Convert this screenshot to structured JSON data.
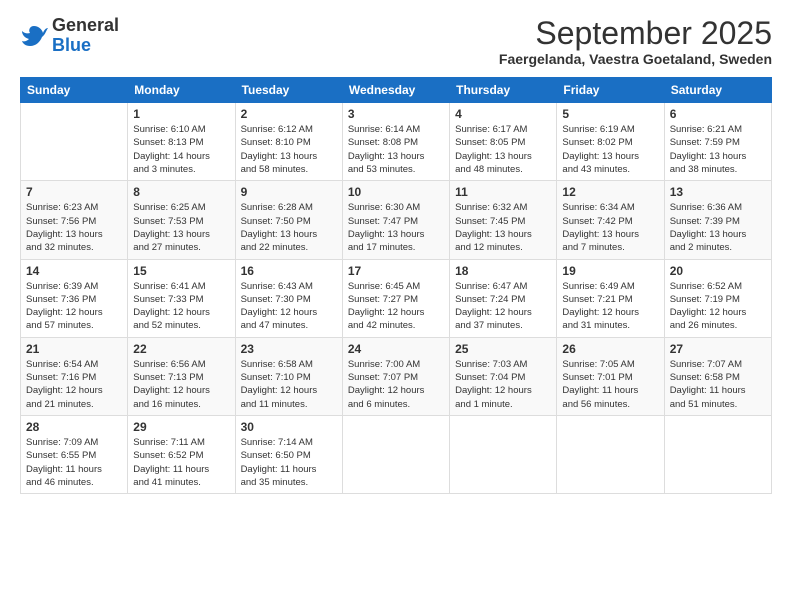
{
  "logo": {
    "general": "General",
    "blue": "Blue"
  },
  "header": {
    "month_title": "September 2025",
    "location": "Faergelanda, Vaestra Goetaland, Sweden"
  },
  "days_of_week": [
    "Sunday",
    "Monday",
    "Tuesday",
    "Wednesday",
    "Thursday",
    "Friday",
    "Saturday"
  ],
  "weeks": [
    [
      {
        "day": "",
        "info": ""
      },
      {
        "day": "1",
        "info": "Sunrise: 6:10 AM\nSunset: 8:13 PM\nDaylight: 14 hours\nand 3 minutes."
      },
      {
        "day": "2",
        "info": "Sunrise: 6:12 AM\nSunset: 8:10 PM\nDaylight: 13 hours\nand 58 minutes."
      },
      {
        "day": "3",
        "info": "Sunrise: 6:14 AM\nSunset: 8:08 PM\nDaylight: 13 hours\nand 53 minutes."
      },
      {
        "day": "4",
        "info": "Sunrise: 6:17 AM\nSunset: 8:05 PM\nDaylight: 13 hours\nand 48 minutes."
      },
      {
        "day": "5",
        "info": "Sunrise: 6:19 AM\nSunset: 8:02 PM\nDaylight: 13 hours\nand 43 minutes."
      },
      {
        "day": "6",
        "info": "Sunrise: 6:21 AM\nSunset: 7:59 PM\nDaylight: 13 hours\nand 38 minutes."
      }
    ],
    [
      {
        "day": "7",
        "info": "Sunrise: 6:23 AM\nSunset: 7:56 PM\nDaylight: 13 hours\nand 32 minutes."
      },
      {
        "day": "8",
        "info": "Sunrise: 6:25 AM\nSunset: 7:53 PM\nDaylight: 13 hours\nand 27 minutes."
      },
      {
        "day": "9",
        "info": "Sunrise: 6:28 AM\nSunset: 7:50 PM\nDaylight: 13 hours\nand 22 minutes."
      },
      {
        "day": "10",
        "info": "Sunrise: 6:30 AM\nSunset: 7:47 PM\nDaylight: 13 hours\nand 17 minutes."
      },
      {
        "day": "11",
        "info": "Sunrise: 6:32 AM\nSunset: 7:45 PM\nDaylight: 13 hours\nand 12 minutes."
      },
      {
        "day": "12",
        "info": "Sunrise: 6:34 AM\nSunset: 7:42 PM\nDaylight: 13 hours\nand 7 minutes."
      },
      {
        "day": "13",
        "info": "Sunrise: 6:36 AM\nSunset: 7:39 PM\nDaylight: 13 hours\nand 2 minutes."
      }
    ],
    [
      {
        "day": "14",
        "info": "Sunrise: 6:39 AM\nSunset: 7:36 PM\nDaylight: 12 hours\nand 57 minutes."
      },
      {
        "day": "15",
        "info": "Sunrise: 6:41 AM\nSunset: 7:33 PM\nDaylight: 12 hours\nand 52 minutes."
      },
      {
        "day": "16",
        "info": "Sunrise: 6:43 AM\nSunset: 7:30 PM\nDaylight: 12 hours\nand 47 minutes."
      },
      {
        "day": "17",
        "info": "Sunrise: 6:45 AM\nSunset: 7:27 PM\nDaylight: 12 hours\nand 42 minutes."
      },
      {
        "day": "18",
        "info": "Sunrise: 6:47 AM\nSunset: 7:24 PM\nDaylight: 12 hours\nand 37 minutes."
      },
      {
        "day": "19",
        "info": "Sunrise: 6:49 AM\nSunset: 7:21 PM\nDaylight: 12 hours\nand 31 minutes."
      },
      {
        "day": "20",
        "info": "Sunrise: 6:52 AM\nSunset: 7:19 PM\nDaylight: 12 hours\nand 26 minutes."
      }
    ],
    [
      {
        "day": "21",
        "info": "Sunrise: 6:54 AM\nSunset: 7:16 PM\nDaylight: 12 hours\nand 21 minutes."
      },
      {
        "day": "22",
        "info": "Sunrise: 6:56 AM\nSunset: 7:13 PM\nDaylight: 12 hours\nand 16 minutes."
      },
      {
        "day": "23",
        "info": "Sunrise: 6:58 AM\nSunset: 7:10 PM\nDaylight: 12 hours\nand 11 minutes."
      },
      {
        "day": "24",
        "info": "Sunrise: 7:00 AM\nSunset: 7:07 PM\nDaylight: 12 hours\nand 6 minutes."
      },
      {
        "day": "25",
        "info": "Sunrise: 7:03 AM\nSunset: 7:04 PM\nDaylight: 12 hours\nand 1 minute."
      },
      {
        "day": "26",
        "info": "Sunrise: 7:05 AM\nSunset: 7:01 PM\nDaylight: 11 hours\nand 56 minutes."
      },
      {
        "day": "27",
        "info": "Sunrise: 7:07 AM\nSunset: 6:58 PM\nDaylight: 11 hours\nand 51 minutes."
      }
    ],
    [
      {
        "day": "28",
        "info": "Sunrise: 7:09 AM\nSunset: 6:55 PM\nDaylight: 11 hours\nand 46 minutes."
      },
      {
        "day": "29",
        "info": "Sunrise: 7:11 AM\nSunset: 6:52 PM\nDaylight: 11 hours\nand 41 minutes."
      },
      {
        "day": "30",
        "info": "Sunrise: 7:14 AM\nSunset: 6:50 PM\nDaylight: 11 hours\nand 35 minutes."
      },
      {
        "day": "",
        "info": ""
      },
      {
        "day": "",
        "info": ""
      },
      {
        "day": "",
        "info": ""
      },
      {
        "day": "",
        "info": ""
      }
    ]
  ]
}
